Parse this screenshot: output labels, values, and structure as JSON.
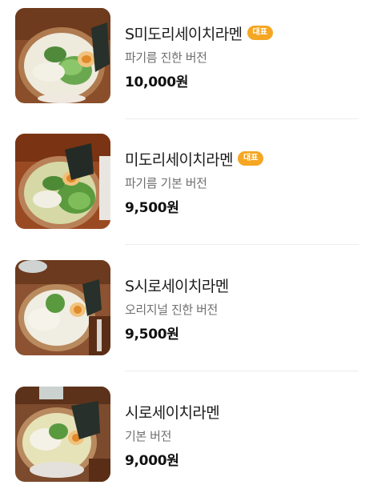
{
  "menu": {
    "items": [
      {
        "name": "S미도리세이치라멘",
        "badge": "대표",
        "description": "파기름 진한 버전",
        "price": "10,000원",
        "image": "ramen-green-onion-photo",
        "broth_color": "#eeeadc"
      },
      {
        "name": "미도리세이치라멘",
        "badge": "대표",
        "description": "파기름 기본 버전",
        "price": "9,500원",
        "image": "ramen-green-onion-photo",
        "broth_color": "#d6d9a6"
      },
      {
        "name": "S시로세이치라멘",
        "badge": "",
        "description": "오리지널 진한 버전",
        "price": "9,500원",
        "image": "ramen-white-broth-photo",
        "broth_color": "#f0ede2"
      },
      {
        "name": "시로세이치라멘",
        "badge": "",
        "description": "기본 버전",
        "price": "9,000원",
        "image": "ramen-white-broth-photo",
        "broth_color": "#e6e3b8"
      }
    ]
  },
  "colors": {
    "badge": "#f5a623",
    "name_text": "#1c1c1c",
    "description_text": "#6f6f6f",
    "price_text": "#111111",
    "divider": "#ececec"
  }
}
